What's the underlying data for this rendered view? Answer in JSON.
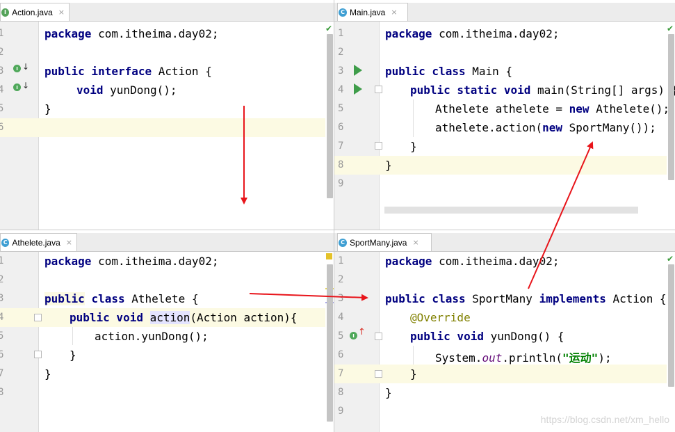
{
  "panes": [
    {
      "id": "action",
      "tab": {
        "name": "Action.java",
        "icon": "interface-icon",
        "icon_letter": "I",
        "close": "×"
      },
      "lines": [
        "1",
        "2",
        "3",
        "4",
        "5",
        "6"
      ],
      "code": {
        "l1": {
          "kw": "package",
          "rest": " com.itheima.day02;"
        },
        "l3": {
          "kw": "public interface",
          "rest": " Action {"
        },
        "l4": {
          "kw": "void",
          "rest": " yunDong();"
        },
        "l5": {
          "rest": "}"
        }
      }
    },
    {
      "id": "main",
      "tab": {
        "name": "Main.java",
        "icon": "class-icon",
        "icon_letter": "C",
        "close": "×"
      },
      "lines": [
        "1",
        "2",
        "3",
        "4",
        "5",
        "6",
        "7",
        "8",
        "9"
      ],
      "code": {
        "l1": {
          "kw": "package",
          "rest": " com.itheima.day02;"
        },
        "l3": {
          "kw": "public class",
          "rest": " Main {"
        },
        "l4": {
          "kw": "public static void",
          "rest": " main(String[] args) {"
        },
        "l5": {
          "pre": "Athelete athelete = ",
          "kw": "new",
          "rest": " Athelete();"
        },
        "l6": {
          "pre": "athelete.action(",
          "kw": "new",
          "rest": " SportMany());"
        },
        "l7": {
          "rest": "}"
        },
        "l8": {
          "rest": "}"
        }
      }
    },
    {
      "id": "athelete",
      "tab": {
        "name": "Athelete.java",
        "icon": "class-icon",
        "icon_letter": "C",
        "close": "×"
      },
      "lines": [
        "1",
        "2",
        "3",
        "4",
        "5",
        "6",
        "7",
        "8"
      ],
      "code": {
        "l1": {
          "kw": "package",
          "rest": " com.itheima.day02;"
        },
        "l3": {
          "kw1": "public",
          "kw2": "class",
          "rest": " Athelete {"
        },
        "l4": {
          "kw": "public void",
          "sel": "action",
          "rest": "(Action action){"
        },
        "l5": {
          "rest": "action.yunDong();"
        },
        "l6": {
          "rest": "}"
        },
        "l7": {
          "rest": "}"
        }
      }
    },
    {
      "id": "sportmany",
      "tab": {
        "name": "SportMany.java",
        "icon": "class-icon",
        "icon_letter": "C",
        "close": "×"
      },
      "lines": [
        "1",
        "2",
        "3",
        "4",
        "5",
        "6",
        "7",
        "8",
        "9"
      ],
      "code": {
        "l1": {
          "kw": "package",
          "rest": " com.itheima.day02;"
        },
        "l3": {
          "kw": "public class",
          "mid": " SportMany ",
          "kw2": "implements",
          "rest": " Action {"
        },
        "l4": {
          "ann": "@Override"
        },
        "l5": {
          "kw": "public void",
          "rest": " yunDong() {"
        },
        "l6": {
          "pre": "System.",
          "field": "out",
          "mid": ".println(",
          "str": "\"运动\"",
          "rest": ");"
        },
        "l7": {
          "rest": "}"
        },
        "l8": {
          "rest": "}"
        }
      }
    }
  ],
  "watermark": "https://blog.csdn.net/xm_hello",
  "colors": {
    "keyword": "#000080",
    "annotation": "#808000",
    "string": "#008000",
    "arrow": "#e8141a",
    "current_line": "#fcfae3"
  }
}
